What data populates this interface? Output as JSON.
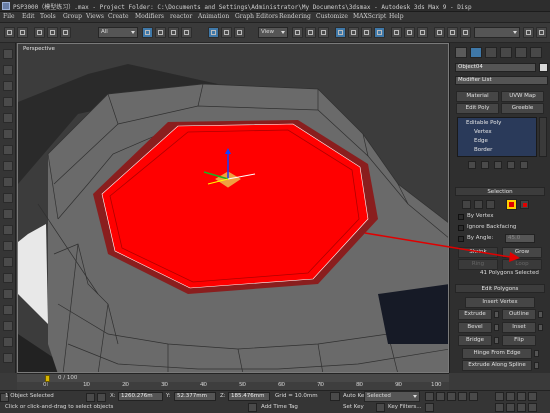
{
  "window": {
    "title": "PSP3000（模型练习）.max  - Project Folder: C:\\Documents and Settings\\Administrator\\My Documents\\3dsmax  - Autodesk 3ds Max 9   - Disp"
  },
  "menu": [
    "File",
    "Edit",
    "Tools",
    "Group",
    "Views",
    "Create",
    "Modifiers",
    "reactor",
    "Animation",
    "Graph Editors",
    "Rendering",
    "Customize",
    "MAXScript",
    "Help"
  ],
  "toolbar": {
    "selection_filter": "All",
    "coord_system": "View"
  },
  "viewport": {
    "label": "Perspective"
  },
  "command_panel": {
    "object_name": "Object04",
    "object_color": "#d8d8d8",
    "modifier_list": "Modifier List",
    "buttons": {
      "material": "Material",
      "uvw_map": "UVW Map",
      "edit_poly": "Edit Poly",
      "greeble": "Greeble"
    },
    "stack": {
      "root": "Editable Poly",
      "items": [
        "Vertex",
        "Edge",
        "Border",
        "Polygon"
      ]
    },
    "selection": {
      "header": "Selection",
      "by_vertex": "By Vertex",
      "ignore_backfacing": "Ignore Backfacing",
      "by_angle": "By Angle:",
      "angle_value": "45.0",
      "shrink": "Shrink",
      "grow": "Grow",
      "ring": "Ring",
      "loop": "Loop",
      "status": "41 Polygons Selected"
    },
    "edit_polygons": {
      "header": "Edit Polygons",
      "insert_vertex": "Insert Vertex",
      "extrude": "Extrude",
      "outline": "Outline",
      "bevel": "Bevel",
      "inset": "Inset",
      "bridge": "Bridge",
      "flip": "Flip",
      "hinge": "Hinge From Edge",
      "extrude_spline": "Extrude Along Spline",
      "edit_tri": "Edit Triangulation"
    }
  },
  "timeline": {
    "frame_label": "0 / 100",
    "ticks": [
      "0",
      "10",
      "20",
      "30",
      "40",
      "50",
      "60",
      "70",
      "80",
      "90",
      "100"
    ]
  },
  "status": {
    "selected": "1 Object Selected",
    "prompt": "Click or click-and-drag to select objects",
    "x_label": "X:",
    "x": "1260.276m",
    "y_label": "Y:",
    "y": "52.377mm",
    "z_label": "Z:",
    "z": "185.476mm",
    "grid": "Grid = 10.0mm",
    "auto_key": "Auto Key",
    "set_key": "Set Key",
    "key_mode": "Selected",
    "key_filters": "Key Filters...",
    "add_time_tag": "Add Time Tag"
  },
  "colors": {
    "selection_red": "#ff0000",
    "annotation_arrow": "#e00000",
    "viewport_gray": "#3c3c3c"
  }
}
